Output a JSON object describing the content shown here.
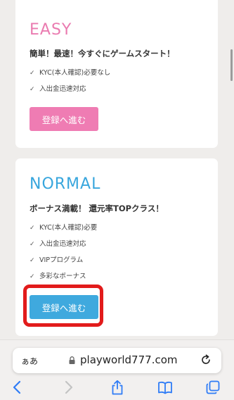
{
  "plans": {
    "easy": {
      "title": "EASY",
      "tagline": "簡単！最速！今すぐにゲームスタート！",
      "features": [
        "KYC(本人確認)必要なし",
        "入出金迅速対応"
      ],
      "cta": "登録へ進む",
      "color": "#ef7cb3"
    },
    "normal": {
      "title": "NORMAL",
      "tagline": "ボーナス満載！ 還元率TOPクラス！",
      "features": [
        "KYC(本人確認)必要",
        "入出金迅速対応",
        "VIPプログラム",
        "多彩なボーナス"
      ],
      "cta": "登録へ進む",
      "color": "#3fa9de"
    }
  },
  "highlight_color": "#e21b1b",
  "browser": {
    "text_size_label": "ぁあ",
    "url": "playworld777.com",
    "icons": [
      "lock-icon",
      "reload-icon",
      "back-icon",
      "forward-icon",
      "share-icon",
      "bookmarks-icon",
      "tabs-icon"
    ]
  }
}
